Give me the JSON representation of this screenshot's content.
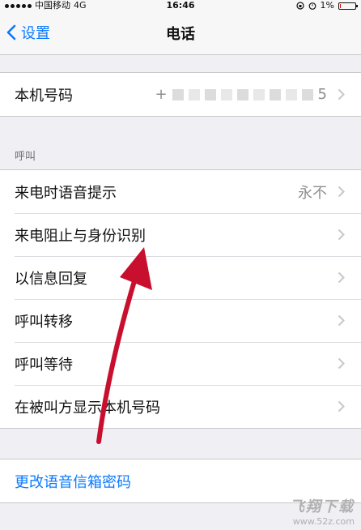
{
  "status_bar": {
    "carrier": "中国移动",
    "network": "4G",
    "time": "16:46",
    "battery_percent_text": "1%",
    "battery_level": 0.01
  },
  "nav": {
    "back_label": "设置",
    "title": "电话"
  },
  "my_number": {
    "label": "本机号码",
    "value_prefix": "+",
    "value_suffix": "5"
  },
  "calls_section": {
    "header": "呼叫",
    "items": [
      {
        "label": "来电时语音提示",
        "value": "永不"
      },
      {
        "label": "来电阻止与身份识别",
        "value": ""
      },
      {
        "label": "以信息回复",
        "value": ""
      },
      {
        "label": "呼叫转移",
        "value": ""
      },
      {
        "label": "呼叫等待",
        "value": ""
      },
      {
        "label": "在被叫方显示本机号码",
        "value": ""
      }
    ]
  },
  "voicemail": {
    "label": "更改语音信箱密码"
  },
  "watermark": {
    "main": "飞翔下载",
    "sub": "www.52z.com"
  },
  "colors": {
    "accent": "#0a7aff",
    "annotation_arrow": "#c8102e",
    "background": "#efeff4"
  }
}
